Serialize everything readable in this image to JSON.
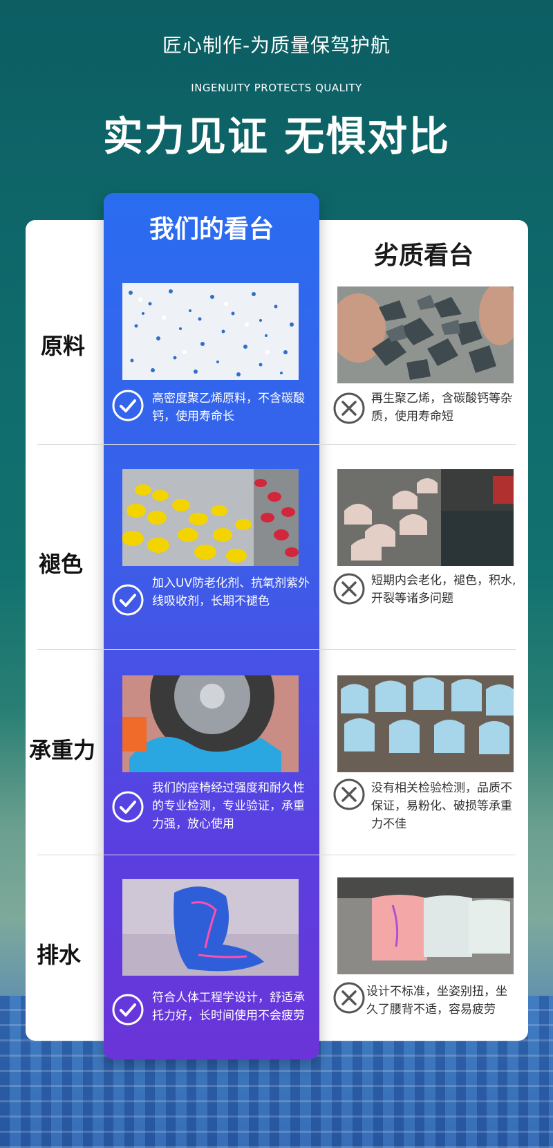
{
  "header": {
    "title_line": "匠心制作-为质量保驾护航",
    "subtitle": "INGENUITY PROTECTS QUALITY",
    "headline": "实力见证 无惧对比"
  },
  "columns": {
    "ours": "我们的看台",
    "inferior": "劣质看台"
  },
  "rows": [
    {
      "label": "原料",
      "ours_text": "高密度聚乙烯原料，不含碳酸钙，使用寿命长",
      "inferior_text": "再生聚乙烯，含碳酸钙等杂质，使用寿命短"
    },
    {
      "label": "褪色",
      "ours_text": "加入UV防老化剂、抗氧剂紫外线吸收剂，长期不褪色",
      "inferior_text": "短期内会老化，褪色，积水,开裂等诸多问题"
    },
    {
      "label": "承重力",
      "ours_text": "我们的座椅经过强度和耐久性的专业检测，专业验证，承重力强，放心使用",
      "inferior_text": "没有相关检验检测，品质不保证，易粉化、破损等承重力不佳"
    },
    {
      "label": "排水",
      "ours_text": "符合人体工程学设计，舒适承托力好，长时间使用不会疲劳",
      "inferior_text": "设计不标准，坐姿别扭，坐久了腰背不适，容易疲劳"
    }
  ],
  "icons": {
    "good": "check-circle-icon",
    "bad": "x-circle-icon"
  },
  "colors": {
    "accent_blue": "#2a6cf0",
    "accent_purple": "#6a34d8",
    "background_teal": "#0c5e63"
  }
}
